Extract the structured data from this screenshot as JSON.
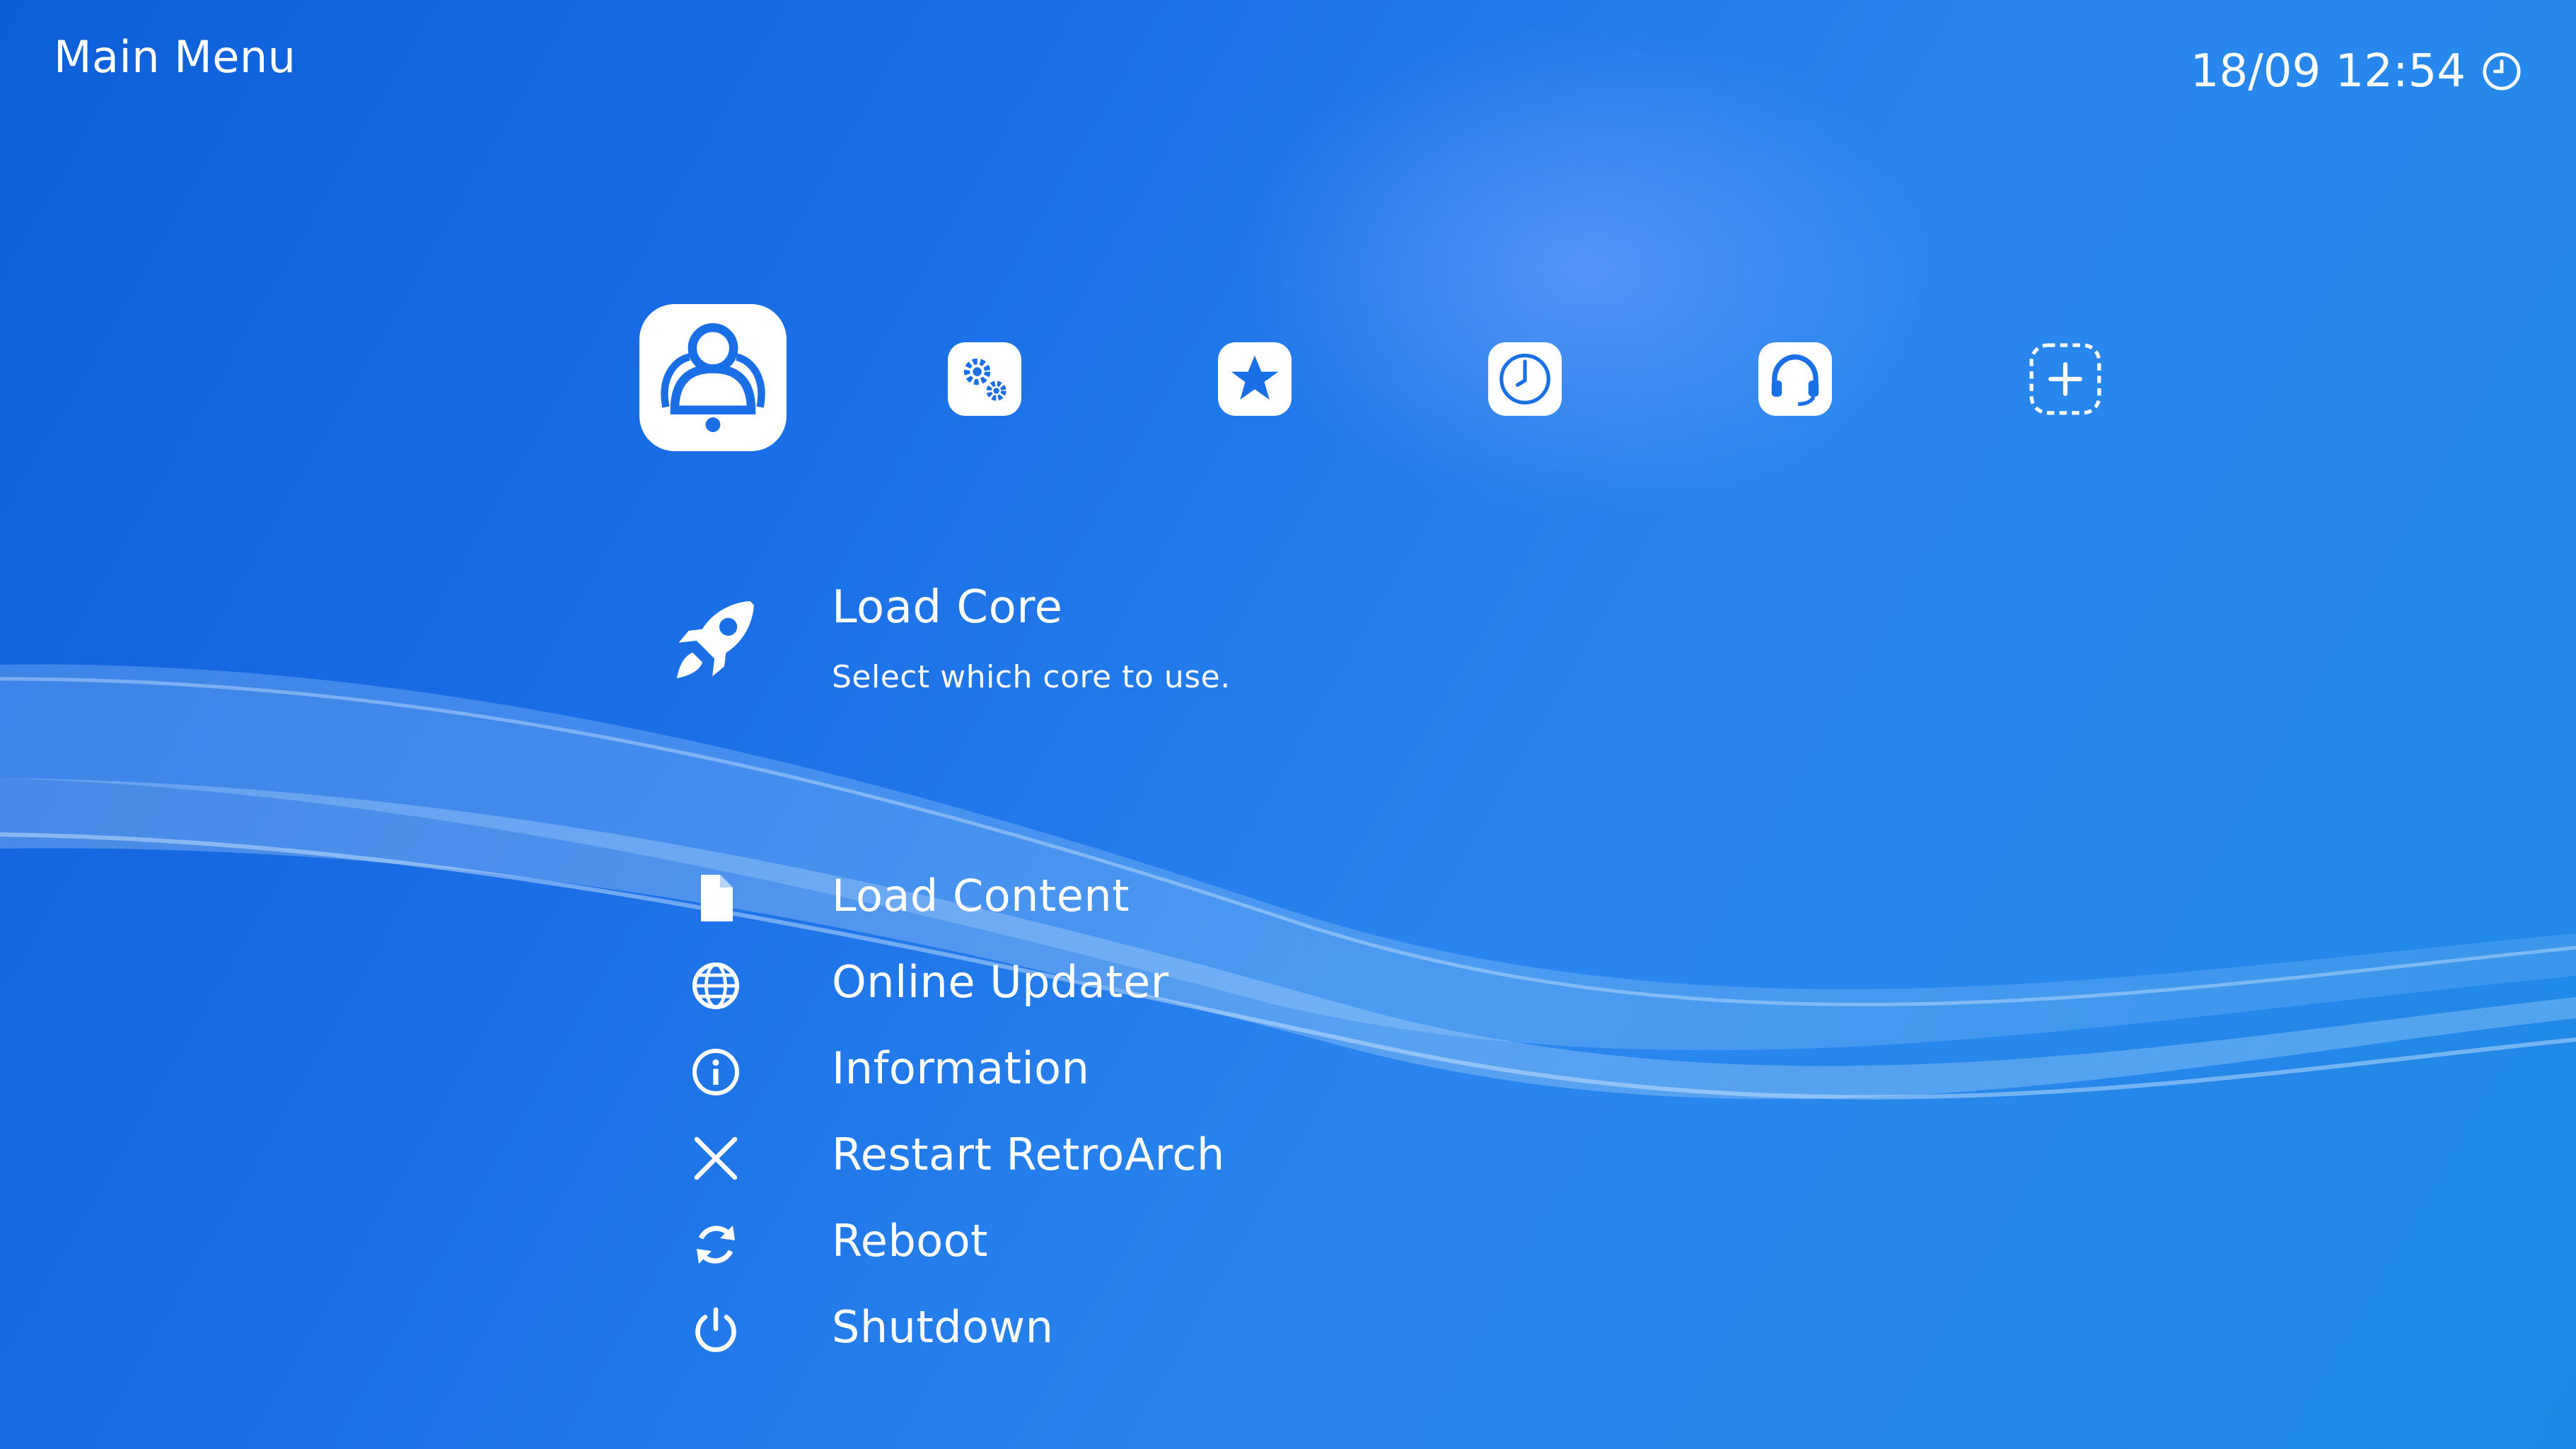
{
  "header": {
    "title": "Main Menu"
  },
  "clock": {
    "datetime": "18/09 12:54",
    "icon": "clock-icon"
  },
  "tabs": [
    {
      "name": "main-menu",
      "icon": "retroarch-logo-icon",
      "selected": true
    },
    {
      "name": "settings",
      "icon": "gears-icon"
    },
    {
      "name": "favorites",
      "icon": "star-icon"
    },
    {
      "name": "history",
      "icon": "clock-icon"
    },
    {
      "name": "netplay",
      "icon": "headset-icon"
    },
    {
      "name": "import-content",
      "icon": "add-icon"
    }
  ],
  "menu": {
    "selected": {
      "label": "Load Core",
      "sublabel": "Select which core to use.",
      "icon": "rocket-icon"
    },
    "items": [
      {
        "label": "Load Content",
        "icon": "file-icon"
      },
      {
        "label": "Online Updater",
        "icon": "globe-icon"
      },
      {
        "label": "Information",
        "icon": "info-icon"
      },
      {
        "label": "Restart RetroArch",
        "icon": "close-x-icon"
      },
      {
        "label": "Reboot",
        "icon": "refresh-icon"
      },
      {
        "label": "Shutdown",
        "icon": "power-icon"
      }
    ]
  },
  "colors": {
    "background": "#1a6ee6",
    "text": "#ffffff",
    "icon_fill": "#ffffff"
  }
}
